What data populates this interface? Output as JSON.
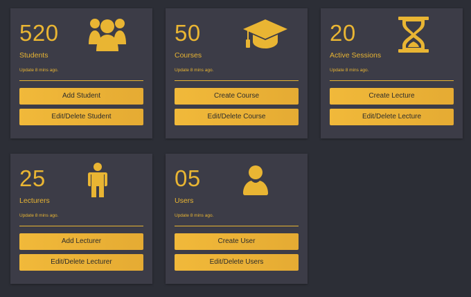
{
  "accent_color": "#e9b533",
  "background_color": "#2c2e36",
  "card_color": "#3c3c47",
  "cards": [
    {
      "count": "520",
      "label": "Students",
      "update": "Update 8 mins ago.",
      "icon": "users-group-icon",
      "btn1": "Add Student",
      "btn2": "Edit/Delete Student"
    },
    {
      "count": "50",
      "label": "Courses",
      "update": "Update 8 mins ago.",
      "icon": "graduation-cap-icon",
      "btn1": "Create Course",
      "btn2": "Edit/Delete Course"
    },
    {
      "count": "20",
      "label": "Active Sessions",
      "update": "Update 8 mins ago.",
      "icon": "hourglass-icon",
      "btn1": "Create Lecture",
      "btn2": "Edit/Delete Lecture"
    },
    {
      "count": "25",
      "label": "Lecturers",
      "update": "Update 8 mins ago.",
      "icon": "person-standing-icon",
      "btn1": "Add Lecturer",
      "btn2": "Edit/Delete Lecturer"
    },
    {
      "count": "05",
      "label": "Users",
      "update": "Update 8 mins ago.",
      "icon": "user-icon",
      "btn1": "Create User",
      "btn2": "Edit/Delete Users"
    }
  ]
}
